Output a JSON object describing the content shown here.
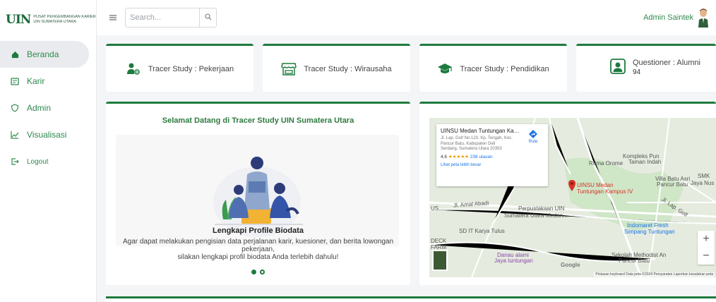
{
  "logo": {
    "mark": "UIN",
    "text_line1": "PUSAT PENGEMBANGAN KARIER",
    "text_line2": "UIN SUMATERA UTARA"
  },
  "sidebar": {
    "items": [
      {
        "label": "Beranda",
        "icon": "home-icon",
        "active": true
      },
      {
        "label": "Karir",
        "icon": "briefcase-icon"
      },
      {
        "label": "Admin",
        "icon": "shield-icon"
      },
      {
        "label": "Visualisasi",
        "icon": "chart-line-icon"
      },
      {
        "label": "Logout",
        "icon": "logout-icon"
      }
    ]
  },
  "topbar": {
    "search_placeholder": "Search...",
    "user_name": "Admin Saintek"
  },
  "stats": [
    {
      "label": "Tracer Study : Pekerjaan",
      "icon": "user-gear-icon"
    },
    {
      "label": "Tracer Study : Wirausaha",
      "icon": "store-icon"
    },
    {
      "label": "Tracer Study : Pendidikan",
      "icon": "graduation-cap-icon"
    },
    {
      "label": "Questioner : Alumni",
      "count": "94",
      "icon": "user-card-icon"
    }
  ],
  "welcome": {
    "title": "Selamat Datang di Tracer Study UIN Sumatera Utara",
    "slide_title": "Lengkapi Profile Biodata",
    "slide_desc_line1": "Agar dapat melakukan pengisian data perjalanan karir, kuesioner, dan berita lowongan pekerjaan,",
    "slide_desc_line2": "silakan lengkapi profil biodata Anda terlebih dahulu!"
  },
  "map": {
    "place_name": "UINSU Medan Tuntungan Kam...",
    "address_line1": "Jl. Lap. Golf No.120, Kp. Tengah, Kec.",
    "address_line2": "Pancur Batu, Kabupaten Deli",
    "address_line3": "Serdang, Sumatera Utara 20353",
    "rating": "4,6",
    "stars": "★★★★★",
    "reviews": "236 ulasan",
    "view_larger": "Lihat peta lebih besar",
    "route_label": "Rute",
    "labels": {
      "ruma_orome": "Ruma Orome",
      "kompleks": "Kompleks Pun",
      "kompleks2": "Taman Indah",
      "villa": "Villa Batu Asri",
      "villa2": "Pancur Batu",
      "smk": "SMK",
      "jaya": "Jaya Nus",
      "marker1": "UINSU Medan",
      "marker2": "Tuntungan Kampus IV",
      "perpus1": "Perpustakaan UIN",
      "perpus2": "Sumatera Utara Medan...",
      "jl_amal": "Jl. Amal Abadi",
      "us": "US...",
      "sd": "SD IT Karya Tulus",
      "indomaret1": "Indomaret Fresh",
      "indomaret2": "Simpang Tuntungan",
      "sekolah1": "Sekolah Methodist An",
      "sekolah2": "Pancur Batu",
      "danau1": "Danau alami",
      "danau2": "Jaya tuntungan",
      "deck": "DECK",
      "farm": "FARM",
      "lap_golf": "Jl. Lap. Golf"
    },
    "google": "Google",
    "attribution": "Pintasan keyboard   Data peta ©2024   Persyaratan   Laporkan kesalahan peta",
    "zoom_in": "+",
    "zoom_out": "−"
  },
  "colors": {
    "accent": "#1e7a3e",
    "nav_text": "#2e8a4e",
    "marker": "#d93025"
  }
}
